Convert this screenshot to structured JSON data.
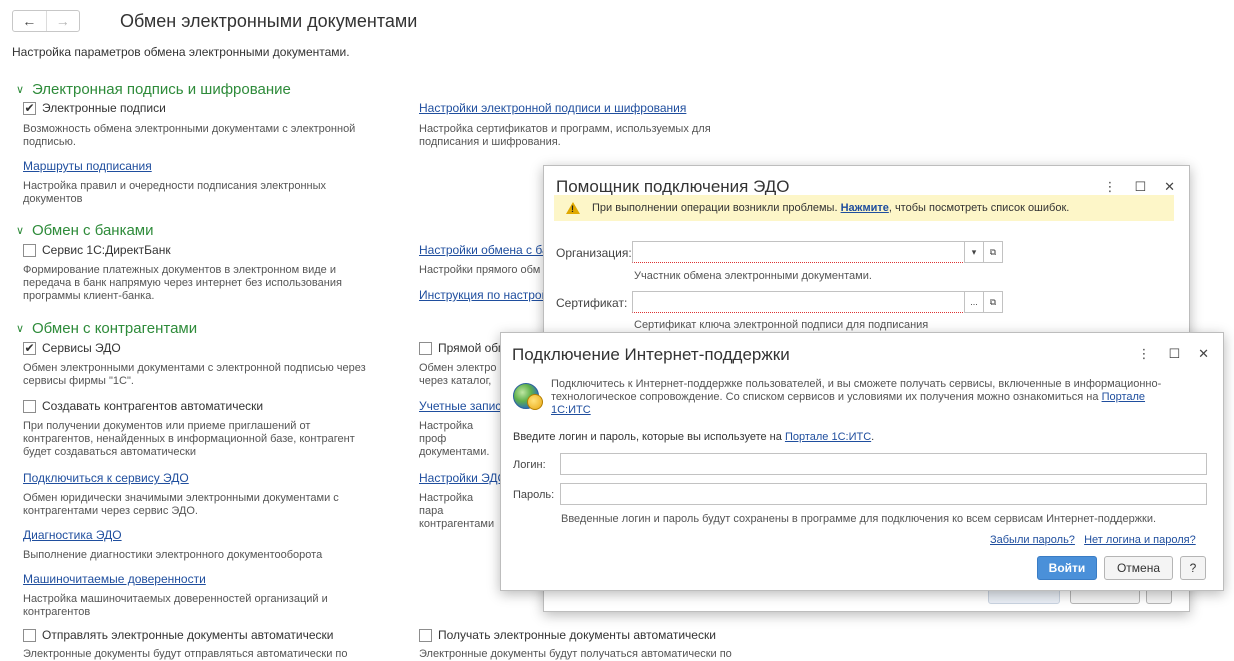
{
  "header": {
    "back_arrow": "←",
    "forward_arrow": "→",
    "title": "Обмен электронными документами",
    "subtitle": "Настройка параметров обмена электронными документами."
  },
  "signature_section": {
    "title": "Электронная подпись и шифрование",
    "signatures_checkbox": {
      "label": "Электронные подписи",
      "checked": true
    },
    "signatures_desc": "Возможность обмена электронными документами с электронной подписью.",
    "settings_link": "Настройки электронной подписи и шифрования",
    "settings_desc": "Настройка сертификатов и программ, используемых для подписания и шифрования.",
    "routes_link": "Маршруты подписания",
    "routes_desc": "Настройка правил и очередности подписания электронных документов"
  },
  "banks_section": {
    "title": "Обмен с банками",
    "directbank_checkbox": {
      "label": "Сервис 1С:ДиректБанк",
      "checked": false
    },
    "directbank_desc": "Формирование платежных документов в электронном виде и передача в банк напрямую через интернет без использования программы клиент-банка.",
    "bank_settings_link": "Настройки обмена с ба",
    "bank_settings_desc": "Настройки прямого обм",
    "instruction_link": "Инструкция по настрой"
  },
  "counterparty_section": {
    "title": "Обмен с контрагентами",
    "edo_checkbox": {
      "label": "Сервисы ЭДО",
      "checked": true
    },
    "edo_desc": "Обмен электронными документами с электронной подписью через сервисы фирмы \"1С\".",
    "direct_checkbox": {
      "label": "Прямой обм",
      "checked": false
    },
    "direct_desc": "Обмен электро через каталог,",
    "auto_create_checkbox": {
      "label": "Создавать контрагентов автоматически",
      "checked": false
    },
    "auto_create_desc": "При получении документов или приеме приглашений от контрагентов, ненайденных в информационной базе, контрагент будет создаваться автоматически",
    "accounts_link": "Учетные запис",
    "accounts_desc": "Настройка проф документами.",
    "connect_link": "Подключиться к сервису ЭДО",
    "connect_desc": "Обмен юридически значимыми электронными документами с контрагентами через сервис ЭДО.",
    "edo_settings_link": "Настройки ЭДС",
    "edo_settings_desc": "Настройка пара контрагентами",
    "diagnostics_link": "Диагностика ЭДО",
    "diagnostics_desc": "Выполнение диагностики электронного документооборота",
    "poa_link": "Машиночитаемые доверенности",
    "poa_desc": "Настройка машиночитаемых доверенностей организаций и контрагентов",
    "send_auto_checkbox": {
      "label": "Отправлять электронные документы автоматически",
      "checked": false
    },
    "send_auto_desc": "Электронные документы будут отправляться автоматически по",
    "receive_auto_checkbox": {
      "label": "Получать электронные документы автоматически",
      "checked": false
    },
    "receive_auto_desc": "Электронные документы будут получаться автоматически по"
  },
  "edo_wizard": {
    "title": "Помощник подключения ЭДО",
    "controls": {
      "more": "⋮",
      "maximize": "☐",
      "close": "✕"
    },
    "warning": {
      "prefix": "При выполнении операции возникли проблемы.",
      "link": "Нажмите",
      "suffix": ", чтобы посмотреть список ошибок."
    },
    "organization_label": "Организация:",
    "organization_value": "",
    "organization_hint": "Участник обмена электронными документами.",
    "certificate_label": "Сертификат:",
    "certificate_value": "",
    "certificate_hint": "Сертификат ключа электронной подписи для подписания",
    "dropdown_glyph": "▾",
    "select_glyph": "...",
    "open_glyph": "⧉"
  },
  "its_dialog": {
    "title": "Подключение Интернет-поддержки",
    "controls": {
      "more": "⋮",
      "maximize": "☐",
      "close": "✕"
    },
    "info_text": "Подключитесь к Интернет-поддержке пользователей, и вы сможете получать сервисы, включенные в информационно-технологическое сопровождение. Со списком сервисов и условиями их получения можно ознакомиться на",
    "info_link": "Портале 1С:ИТС",
    "prompt_text": "Введите логин и пароль, которые вы используете на",
    "prompt_link": "Портале 1С:ИТС",
    "prompt_suffix": ".",
    "login_label": "Логин:",
    "login_value": "",
    "password_label": "Пароль:",
    "password_value": "",
    "save_note": "Введенные логин и пароль будут сохранены в программе для подключения ко всем сервисам Интернет-поддержки.",
    "forgot_link": "Забыли пароль?",
    "no_login_link": "Нет логина и пароля?",
    "login_button": "Войти",
    "cancel_button": "Отмена",
    "help_button": "?"
  },
  "colors": {
    "section_green": "#2e8b3a",
    "link_blue": "#1f4e9e",
    "warning_bg": "#fdf6c8",
    "primary_button": "#4a90d9"
  }
}
